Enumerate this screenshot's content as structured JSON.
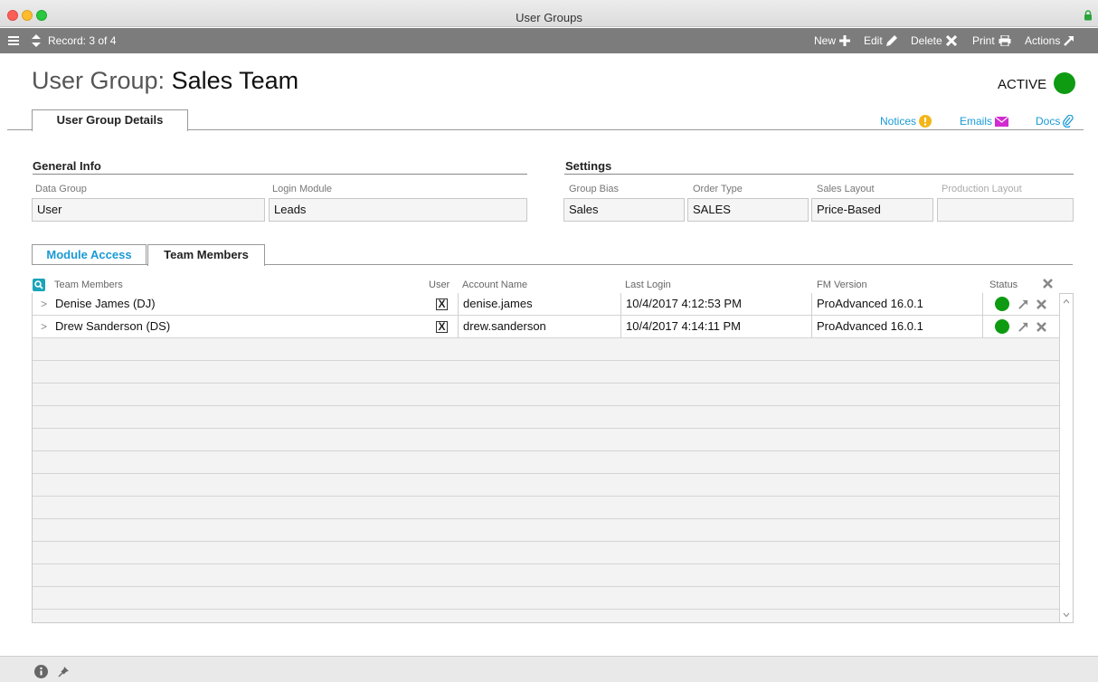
{
  "window": {
    "title": "User Groups"
  },
  "toolbar": {
    "record_label": "Record: 3 of 4",
    "new_label": "New",
    "edit_label": "Edit",
    "delete_label": "Delete",
    "print_label": "Print",
    "actions_label": "Actions"
  },
  "header": {
    "prefix": "User Group:",
    "name": "Sales Team",
    "status_label": "ACTIVE",
    "status_color": "#0e9b12"
  },
  "tabs": {
    "main": "User Group Details"
  },
  "links": {
    "notices": "Notices",
    "emails": "Emails",
    "docs": "Docs"
  },
  "general_info": {
    "title": "General Info",
    "data_group_label": "Data Group",
    "data_group_value": "User",
    "login_module_label": "Login Module",
    "login_module_value": "Leads"
  },
  "settings": {
    "title": "Settings",
    "group_bias_label": "Group Bias",
    "group_bias_value": "Sales",
    "order_type_label": "Order Type",
    "order_type_value": "SALES",
    "sales_layout_label": "Sales Layout",
    "sales_layout_value": "Price-Based",
    "production_layout_label": "Production Layout",
    "production_layout_value": ""
  },
  "sub_tabs": {
    "module_access": "Module Access",
    "team_members": "Team Members"
  },
  "table": {
    "headers": {
      "members": "Team Members",
      "user": "User",
      "account": "Account Name",
      "last_login": "Last Login",
      "fm_version": "FM Version",
      "status": "Status"
    },
    "rows": [
      {
        "name": "Denise James  (DJ)",
        "user_checked": "X",
        "account": "denise.james",
        "last_login": "10/4/2017 4:12:53 PM",
        "fm_version": "ProAdvanced 16.0.1"
      },
      {
        "name": "Drew Sanderson  (DS)",
        "user_checked": "X",
        "account": "drew.sanderson",
        "last_login": "10/4/2017 4:14:11 PM",
        "fm_version": "ProAdvanced 16.0.1"
      }
    ]
  }
}
